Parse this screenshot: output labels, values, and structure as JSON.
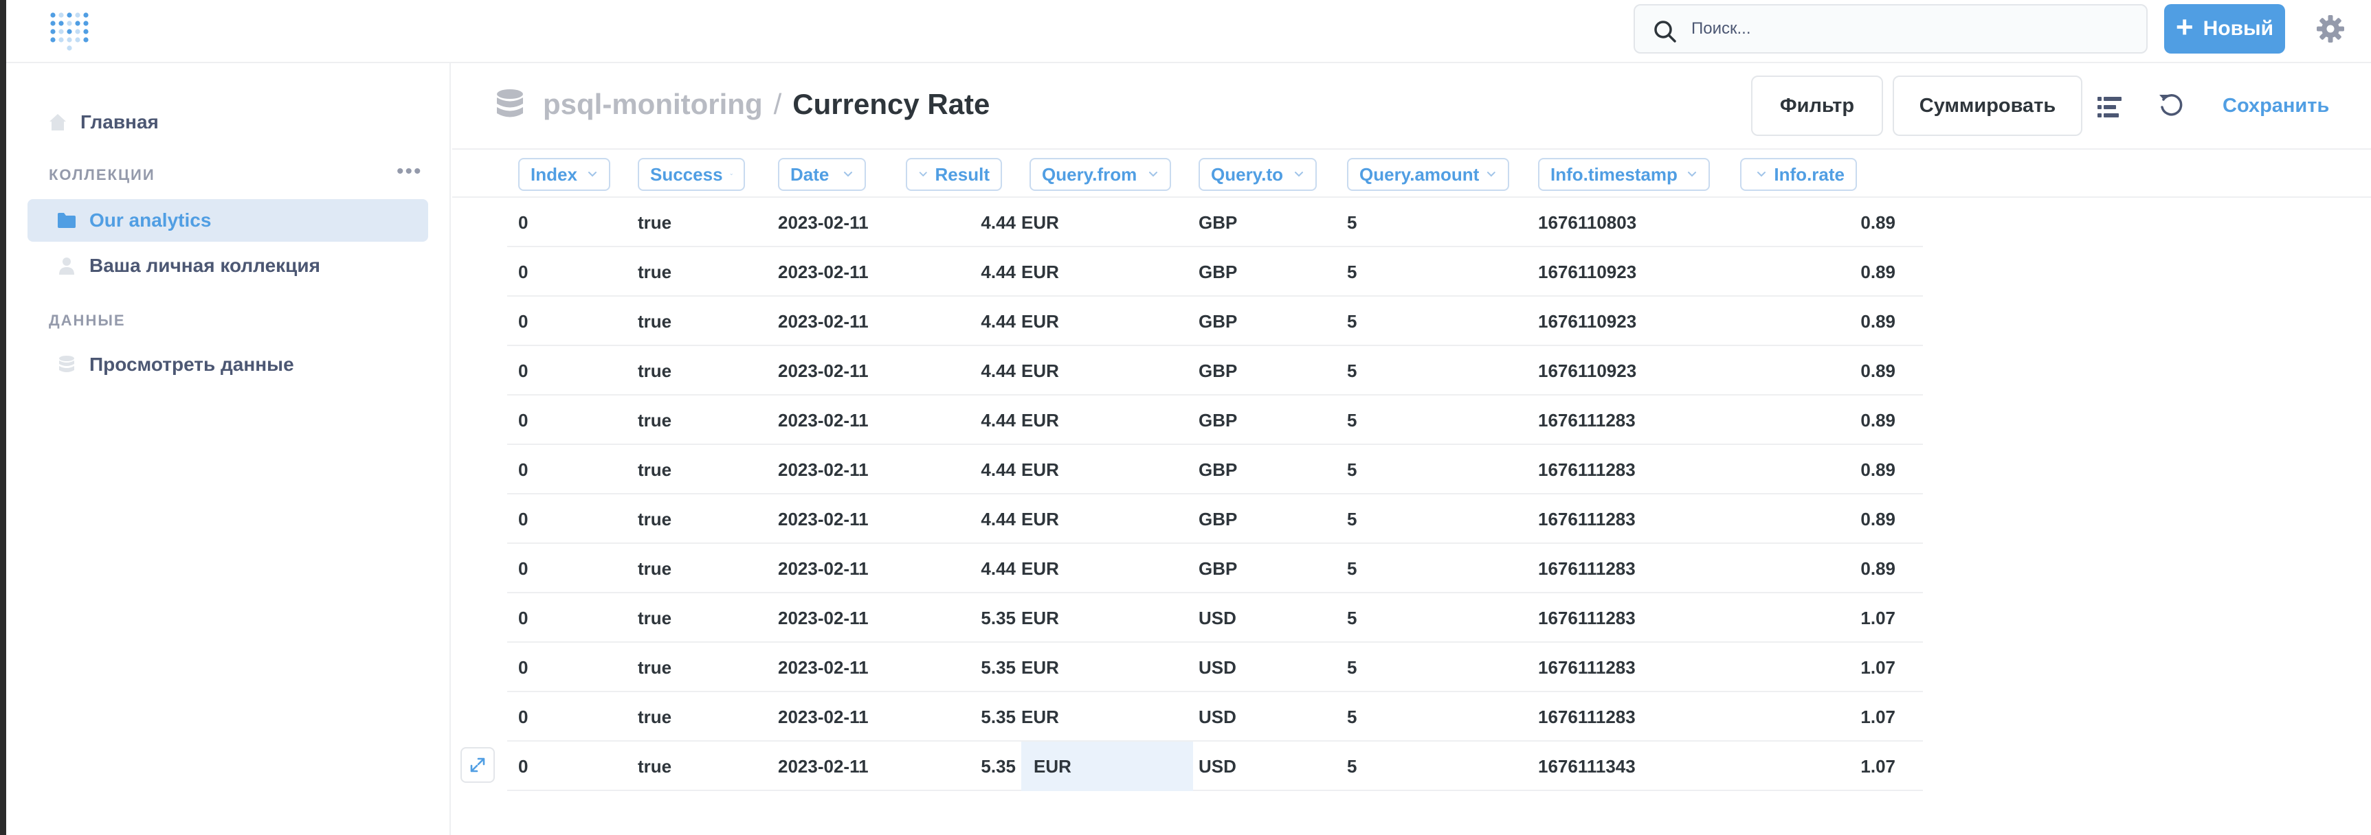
{
  "topbar": {
    "search_placeholder": "Поиск...",
    "new_label": "Новый"
  },
  "sidebar": {
    "home_label": "Главная",
    "collections_label": "КОЛЛЕКЦИИ",
    "collections": [
      {
        "label": "Our analytics",
        "active": true
      },
      {
        "label": "Ваша личная коллекция",
        "active": false
      }
    ],
    "data_label": "ДАННЫЕ",
    "browse_label": "Просмотреть данные"
  },
  "header": {
    "database": "psql-monitoring",
    "separator": "/",
    "title": "Currency Rate",
    "filter_label": "Фильтр",
    "summarize_label": "Суммировать",
    "save_label": "Сохранить"
  },
  "table": {
    "columns": [
      "Index",
      "Success",
      "Date",
      "Result",
      "Query.from",
      "Query.to",
      "Query.amount",
      "Info.timestamp",
      "Info.rate"
    ],
    "rows": [
      [
        "0",
        "true",
        "2023-02-11",
        "4.44",
        "EUR",
        "GBP",
        "5",
        "1676110803",
        "0.89"
      ],
      [
        "0",
        "true",
        "2023-02-11",
        "4.44",
        "EUR",
        "GBP",
        "5",
        "1676110923",
        "0.89"
      ],
      [
        "0",
        "true",
        "2023-02-11",
        "4.44",
        "EUR",
        "GBP",
        "5",
        "1676110923",
        "0.89"
      ],
      [
        "0",
        "true",
        "2023-02-11",
        "4.44",
        "EUR",
        "GBP",
        "5",
        "1676110923",
        "0.89"
      ],
      [
        "0",
        "true",
        "2023-02-11",
        "4.44",
        "EUR",
        "GBP",
        "5",
        "1676111283",
        "0.89"
      ],
      [
        "0",
        "true",
        "2023-02-11",
        "4.44",
        "EUR",
        "GBP",
        "5",
        "1676111283",
        "0.89"
      ],
      [
        "0",
        "true",
        "2023-02-11",
        "4.44",
        "EUR",
        "GBP",
        "5",
        "1676111283",
        "0.89"
      ],
      [
        "0",
        "true",
        "2023-02-11",
        "4.44",
        "EUR",
        "GBP",
        "5",
        "1676111283",
        "0.89"
      ],
      [
        "0",
        "true",
        "2023-02-11",
        "5.35",
        "EUR",
        "USD",
        "5",
        "1676111283",
        "1.07"
      ],
      [
        "0",
        "true",
        "2023-02-11",
        "5.35",
        "EUR",
        "USD",
        "5",
        "1676111283",
        "1.07"
      ],
      [
        "0",
        "true",
        "2023-02-11",
        "5.35",
        "EUR",
        "USD",
        "5",
        "1676111283",
        "1.07"
      ],
      [
        "0",
        "true",
        "2023-02-11",
        "5.35",
        "EUR",
        "USD",
        "5",
        "1676111343",
        "1.07"
      ]
    ]
  },
  "colors": {
    "brand": "#509ee3",
    "text_dark": "#2e353b",
    "text_medium": "#4c5773",
    "text_light": "#949aab",
    "active_bg": "#dfe9f5",
    "border": "#eeeff1"
  }
}
